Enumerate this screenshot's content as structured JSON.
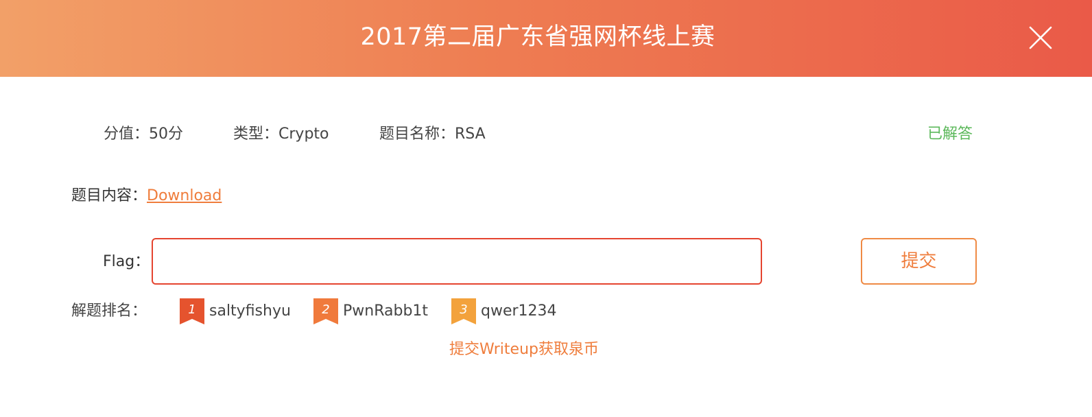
{
  "header": {
    "title": "2017第二届广东省强网杯线上赛",
    "close_icon": "close-icon"
  },
  "meta": {
    "score_label": "分值：",
    "score_value": "50分",
    "type_label": "类型：",
    "type_value": "Crypto",
    "name_label": "题目名称：",
    "name_value": "RSA",
    "status": "已解答"
  },
  "content": {
    "label": "题目内容：",
    "link_text": "Download"
  },
  "flag": {
    "label": "Flag：",
    "value": "",
    "placeholder": "",
    "submit_label": "提交"
  },
  "ranking": {
    "label": "解题排名：",
    "entries": [
      {
        "rank": "1",
        "name": "saltyfishyu",
        "color": "#e5532e"
      },
      {
        "rank": "2",
        "name": "PwnRabb1t",
        "color": "#f07a3c"
      },
      {
        "rank": "3",
        "name": "qwer1234",
        "color": "#f3a23c"
      }
    ]
  },
  "writeup": {
    "text": "提交Writeup获取泉币"
  },
  "colors": {
    "accent": "#ef7d3c",
    "header_start": "#f2a068",
    "header_end": "#ea5a48",
    "success": "#5bb85a",
    "input_border": "#e5442f"
  }
}
